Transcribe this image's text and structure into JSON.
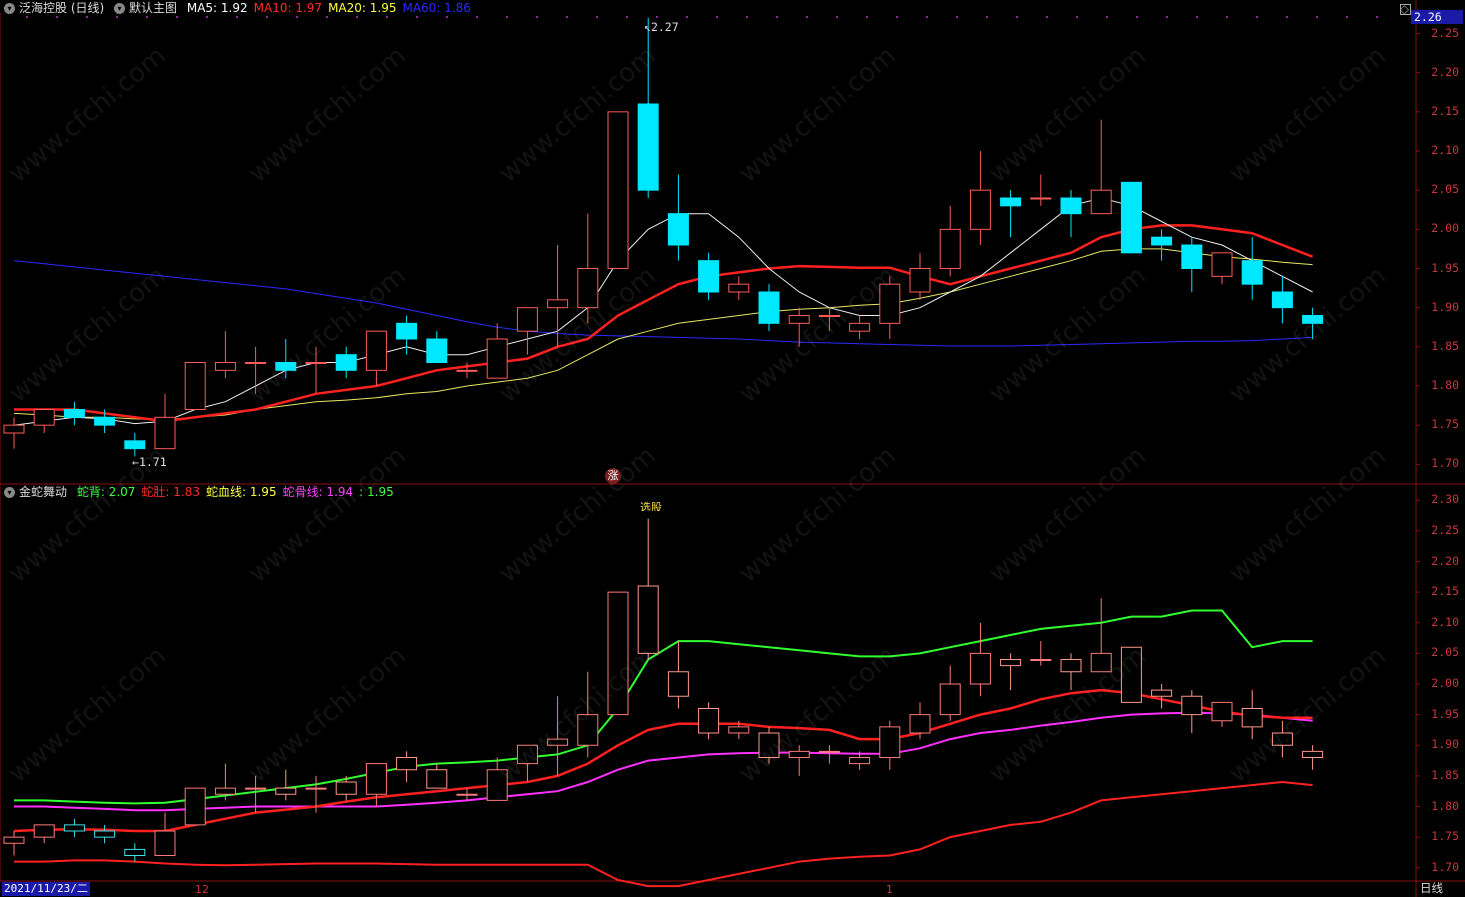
{
  "main_panel": {
    "stock_label": "泛海控股 (日线)",
    "template_label": "默认主图",
    "ma_items": [
      {
        "label": "MA5: 1.92",
        "color": "#ffffff"
      },
      {
        "label": "MA10: 1.97",
        "color": "#ff2a2a"
      },
      {
        "label": "MA20: 1.95",
        "color": "#ffff40"
      },
      {
        "label": "MA60: 1.86",
        "color": "#2a2aff"
      }
    ],
    "y_ticks": [
      "2.25",
      "2.20",
      "2.15",
      "2.10",
      "2.05",
      "2.00",
      "1.95",
      "1.90",
      "1.85",
      "1.80",
      "1.75",
      "1.70"
    ],
    "last_price": "2.26",
    "high_label": "2.27",
    "low_label": "1.71",
    "badge": "涨"
  },
  "indicator_panel": {
    "name": "金蛇舞动",
    "items": [
      {
        "label": "蛇背: 2.07",
        "color": "#40ff40"
      },
      {
        "label": "蛇肚: 1.83",
        "color": "#ff2a2a"
      },
      {
        "label": "蛇血线: 1.95",
        "color": "#ffff40"
      },
      {
        "label": "蛇骨线: 1.94",
        "color": "#ff40ff"
      },
      {
        "label": ": 1.95",
        "color": "#40ff40"
      }
    ],
    "y_ticks": [
      "2.30",
      "2.25",
      "2.20",
      "2.15",
      "2.10",
      "2.05",
      "2.00",
      "1.95",
      "1.90",
      "1.85",
      "1.80",
      "1.75",
      "1.70"
    ],
    "signal_label": "选股"
  },
  "x_axis": {
    "date": "2021/11/23/二",
    "ticks": [
      "12",
      "1"
    ],
    "period": "日线"
  },
  "watermark": "www.cfchi.com",
  "chart_data": {
    "type": "candlestick",
    "candles": [
      {
        "o": 1.74,
        "h": 1.76,
        "l": 1.72,
        "c": 1.75
      },
      {
        "o": 1.75,
        "h": 1.77,
        "l": 1.74,
        "c": 1.77
      },
      {
        "o": 1.77,
        "h": 1.78,
        "l": 1.75,
        "c": 1.76
      },
      {
        "o": 1.76,
        "h": 1.77,
        "l": 1.74,
        "c": 1.75
      },
      {
        "o": 1.73,
        "h": 1.74,
        "l": 1.71,
        "c": 1.72
      },
      {
        "o": 1.72,
        "h": 1.79,
        "l": 1.72,
        "c": 1.76
      },
      {
        "o": 1.77,
        "h": 1.83,
        "l": 1.77,
        "c": 1.83
      },
      {
        "o": 1.82,
        "h": 1.87,
        "l": 1.81,
        "c": 1.83
      },
      {
        "o": 1.83,
        "h": 1.85,
        "l": 1.79,
        "c": 1.83
      },
      {
        "o": 1.83,
        "h": 1.86,
        "l": 1.81,
        "c": 1.82
      },
      {
        "o": 1.83,
        "h": 1.85,
        "l": 1.79,
        "c": 1.83
      },
      {
        "o": 1.84,
        "h": 1.85,
        "l": 1.81,
        "c": 1.82
      },
      {
        "o": 1.82,
        "h": 1.87,
        "l": 1.8,
        "c": 1.87
      },
      {
        "o": 1.88,
        "h": 1.89,
        "l": 1.84,
        "c": 1.86
      },
      {
        "o": 1.86,
        "h": 1.87,
        "l": 1.83,
        "c": 1.83
      },
      {
        "o": 1.82,
        "h": 1.83,
        "l": 1.81,
        "c": 1.82
      },
      {
        "o": 1.81,
        "h": 1.88,
        "l": 1.81,
        "c": 1.86
      },
      {
        "o": 1.87,
        "h": 1.9,
        "l": 1.84,
        "c": 1.9
      },
      {
        "o": 1.9,
        "h": 1.98,
        "l": 1.85,
        "c": 1.91
      },
      {
        "o": 1.9,
        "h": 2.02,
        "l": 1.88,
        "c": 1.95
      },
      {
        "o": 1.95,
        "h": 2.15,
        "l": 1.95,
        "c": 2.15
      },
      {
        "o": 2.16,
        "h": 2.27,
        "l": 2.04,
        "c": 2.05
      },
      {
        "o": 2.02,
        "h": 2.07,
        "l": 1.96,
        "c": 1.98
      },
      {
        "o": 1.96,
        "h": 1.97,
        "l": 1.91,
        "c": 1.92
      },
      {
        "o": 1.92,
        "h": 1.94,
        "l": 1.91,
        "c": 1.93
      },
      {
        "o": 1.92,
        "h": 1.93,
        "l": 1.87,
        "c": 1.88
      },
      {
        "o": 1.88,
        "h": 1.9,
        "l": 1.85,
        "c": 1.89
      },
      {
        "o": 1.89,
        "h": 1.9,
        "l": 1.87,
        "c": 1.89
      },
      {
        "o": 1.87,
        "h": 1.89,
        "l": 1.86,
        "c": 1.88
      },
      {
        "o": 1.88,
        "h": 1.94,
        "l": 1.86,
        "c": 1.93
      },
      {
        "o": 1.92,
        "h": 1.97,
        "l": 1.91,
        "c": 1.95
      },
      {
        "o": 1.95,
        "h": 2.03,
        "l": 1.94,
        "c": 2.0
      },
      {
        "o": 2.0,
        "h": 2.1,
        "l": 1.98,
        "c": 2.05
      },
      {
        "o": 2.04,
        "h": 2.05,
        "l": 1.99,
        "c": 2.03
      },
      {
        "o": 2.04,
        "h": 2.07,
        "l": 2.03,
        "c": 2.04
      },
      {
        "o": 2.04,
        "h": 2.05,
        "l": 1.99,
        "c": 2.02
      },
      {
        "o": 2.02,
        "h": 2.14,
        "l": 2.02,
        "c": 2.05
      },
      {
        "o": 2.06,
        "h": 2.06,
        "l": 1.97,
        "c": 1.97
      },
      {
        "o": 1.99,
        "h": 2.0,
        "l": 1.96,
        "c": 1.98
      },
      {
        "o": 1.98,
        "h": 1.99,
        "l": 1.92,
        "c": 1.95
      },
      {
        "o": 1.94,
        "h": 1.97,
        "l": 1.93,
        "c": 1.97
      },
      {
        "o": 1.96,
        "h": 1.99,
        "l": 1.91,
        "c": 1.93
      },
      {
        "o": 1.92,
        "h": 1.94,
        "l": 1.88,
        "c": 1.9
      },
      {
        "o": 1.89,
        "h": 1.9,
        "l": 1.86,
        "c": 1.88
      }
    ],
    "ma5": [
      1.75,
      1.755,
      1.76,
      1.758,
      1.752,
      1.755,
      1.77,
      1.78,
      1.8,
      1.82,
      1.83,
      1.83,
      1.84,
      1.85,
      1.84,
      1.84,
      1.85,
      1.86,
      1.87,
      1.9,
      1.96,
      2.0,
      2.02,
      2.02,
      1.99,
      1.95,
      1.92,
      1.9,
      1.89,
      1.89,
      1.9,
      1.92,
      1.94,
      1.97,
      2.0,
      2.03,
      2.04,
      2.03,
      2.01,
      1.99,
      1.98,
      1.96,
      1.94,
      1.92
    ],
    "ma10": [
      1.77,
      1.77,
      1.77,
      1.765,
      1.76,
      1.755,
      1.76,
      1.765,
      1.77,
      1.78,
      1.79,
      1.795,
      1.8,
      1.81,
      1.82,
      1.825,
      1.83,
      1.835,
      1.85,
      1.86,
      1.89,
      1.91,
      1.93,
      1.94,
      1.945,
      1.95,
      1.953,
      1.952,
      1.951,
      1.951,
      1.94,
      1.93,
      1.94,
      1.95,
      1.96,
      1.97,
      1.99,
      2.0,
      2.005,
      2.005,
      2.0,
      1.995,
      1.98,
      1.965
    ],
    "ma20": [
      1.765,
      1.763,
      1.76,
      1.76,
      1.758,
      1.757,
      1.76,
      1.763,
      1.77,
      1.775,
      1.78,
      1.782,
      1.785,
      1.79,
      1.793,
      1.8,
      1.805,
      1.81,
      1.82,
      1.84,
      1.86,
      1.87,
      1.88,
      1.885,
      1.89,
      1.895,
      1.898,
      1.9,
      1.903,
      1.905,
      1.912,
      1.92,
      1.93,
      1.94,
      1.95,
      1.96,
      1.972,
      1.975,
      1.975,
      1.97,
      1.965,
      1.962,
      1.958,
      1.955
    ],
    "ma60": [
      1.96,
      1.956,
      1.952,
      1.948,
      1.944,
      1.94,
      1.936,
      1.932,
      1.928,
      1.924,
      1.918,
      1.912,
      1.906,
      1.898,
      1.89,
      1.882,
      1.875,
      1.87,
      1.867,
      1.865,
      1.864,
      1.863,
      1.862,
      1.861,
      1.86,
      1.858,
      1.856,
      1.855,
      1.854,
      1.853,
      1.852,
      1.851,
      1.851,
      1.851,
      1.852,
      1.853,
      1.854,
      1.855,
      1.856,
      1.857,
      1.857,
      1.858,
      1.86,
      1.862
    ],
    "snake_back": [
      1.81,
      1.81,
      1.808,
      1.806,
      1.805,
      1.806,
      1.812,
      1.818,
      1.824,
      1.83,
      1.836,
      1.845,
      1.855,
      1.865,
      1.87,
      1.872,
      1.875,
      1.88,
      1.885,
      1.9,
      1.96,
      2.04,
      2.07,
      2.07,
      2.065,
      2.06,
      2.055,
      2.05,
      2.045,
      2.045,
      2.05,
      2.06,
      2.07,
      2.08,
      2.09,
      2.095,
      2.1,
      2.11,
      2.11,
      2.12,
      2.12,
      2.06,
      2.07,
      2.07
    ],
    "snake_belly": [
      1.71,
      1.71,
      1.712,
      1.712,
      1.71,
      1.707,
      1.705,
      1.704,
      1.705,
      1.706,
      1.707,
      1.707,
      1.707,
      1.706,
      1.705,
      1.705,
      1.705,
      1.705,
      1.705,
      1.705,
      1.68,
      1.67,
      1.67,
      1.68,
      1.69,
      1.7,
      1.71,
      1.715,
      1.718,
      1.72,
      1.73,
      1.75,
      1.76,
      1.77,
      1.775,
      1.79,
      1.81,
      1.815,
      1.82,
      1.825,
      1.83,
      1.835,
      1.84,
      1.835
    ],
    "snake_blood": [
      1.76,
      1.762,
      1.763,
      1.762,
      1.76,
      1.76,
      1.77,
      1.78,
      1.79,
      1.795,
      1.8,
      1.808,
      1.815,
      1.82,
      1.825,
      1.83,
      1.835,
      1.84,
      1.85,
      1.87,
      1.9,
      1.925,
      1.935,
      1.935,
      1.935,
      1.93,
      1.928,
      1.925,
      1.91,
      1.91,
      1.92,
      1.935,
      1.95,
      1.96,
      1.975,
      1.985,
      1.99,
      1.985,
      1.975,
      1.965,
      1.955,
      1.948,
      1.945,
      1.945
    ],
    "snake_bone": [
      1.8,
      1.8,
      1.798,
      1.796,
      1.794,
      1.794,
      1.796,
      1.798,
      1.8,
      1.8,
      1.8,
      1.8,
      1.8,
      1.803,
      1.806,
      1.81,
      1.815,
      1.82,
      1.825,
      1.84,
      1.86,
      1.875,
      1.88,
      1.885,
      1.887,
      1.888,
      1.888,
      1.887,
      1.886,
      1.886,
      1.895,
      1.91,
      1.92,
      1.925,
      1.932,
      1.938,
      1.945,
      1.95,
      1.952,
      1.953,
      1.952,
      1.95,
      1.945,
      1.94
    ]
  }
}
